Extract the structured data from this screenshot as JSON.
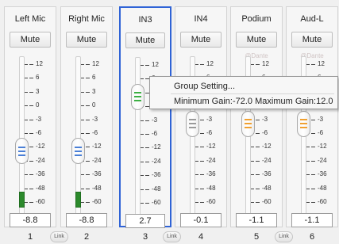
{
  "colors": {
    "selected_border": "#2f63d6",
    "meter_green": "#2c8a2c",
    "fader_grip_green": "#3cb043",
    "fader_grip_blue": "#4a7fd6",
    "fader_grip_orange": "#f0a030",
    "fader_grip_gray": "#9a9a9a"
  },
  "scale_labels": [
    "12",
    "6",
    "3",
    "0",
    "-3",
    "-6",
    "-12",
    "-24",
    "-36",
    "-48",
    "-60"
  ],
  "channels": [
    {
      "name": "Left Mic",
      "mute_label": "Mute",
      "dante": "",
      "gain": "-8.8",
      "number": "1",
      "selected": false,
      "fader_level_db": -12,
      "grip": "blue",
      "meter_level_db": -60
    },
    {
      "name": "Right Mic",
      "mute_label": "Mute",
      "dante": "",
      "gain": "-8.8",
      "number": "2",
      "selected": false,
      "fader_level_db": -12,
      "grip": "blue",
      "meter_level_db": -60
    },
    {
      "name": "IN3",
      "mute_label": "Mute",
      "dante": "",
      "gain": "2.7",
      "number": "3",
      "selected": true,
      "fader_level_db": 3,
      "grip": "green",
      "meter_level_db": null
    },
    {
      "name": "IN4",
      "mute_label": "Mute",
      "dante": "",
      "gain": "-0.1",
      "number": "4",
      "selected": false,
      "fader_level_db": -3,
      "grip": "gray",
      "meter_level_db": null
    },
    {
      "name": "Podium",
      "mute_label": "Mute",
      "dante": "@Dante",
      "gain": "-1.1",
      "number": "5",
      "selected": false,
      "fader_level_db": -3,
      "grip": "orange",
      "meter_level_db": null
    },
    {
      "name": "Aud-L",
      "mute_label": "Mute",
      "dante": "@Dante",
      "gain": "-1.1",
      "number": "6",
      "selected": false,
      "fader_level_db": -3,
      "grip": "orange",
      "meter_level_db": null
    }
  ],
  "link_label": "Link",
  "context_menu": {
    "item": "Group Setting...",
    "info": "Minimum Gain:-72.0 Maximum Gain:12.0"
  }
}
